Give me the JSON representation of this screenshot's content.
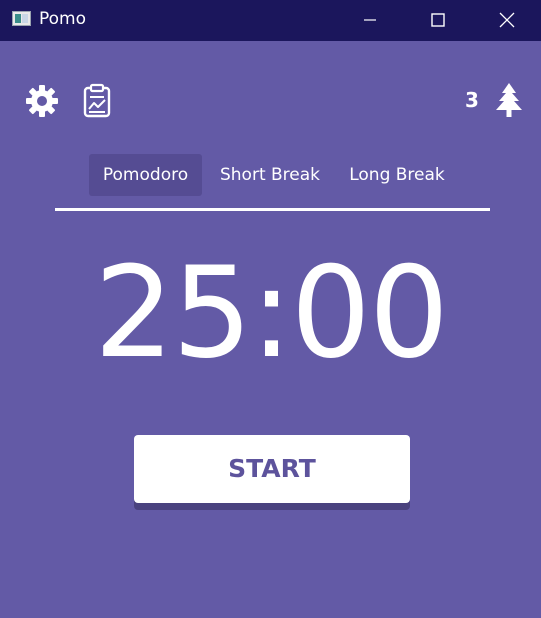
{
  "window": {
    "title": "Pomo",
    "controls": {
      "minimize_icon": "minimize-icon",
      "maximize_icon": "maximize-icon",
      "close_icon": "close-icon"
    }
  },
  "toolbar": {
    "settings_icon": "gear-icon",
    "report_icon": "clipboard-chart-icon",
    "completed_count": "3",
    "count_icon": "tree-icon"
  },
  "tabs": [
    {
      "label": "Pomodoro",
      "active": true
    },
    {
      "label": "Short Break",
      "active": false
    },
    {
      "label": "Long Break",
      "active": false
    }
  ],
  "timer": {
    "display": "25:00"
  },
  "actions": {
    "start_label": "START"
  },
  "colors": {
    "background": "#635aa6",
    "titlebar": "#1b165c",
    "active_tab": "#554c93",
    "button_text": "#5d539c",
    "foreground": "#ffffff"
  }
}
